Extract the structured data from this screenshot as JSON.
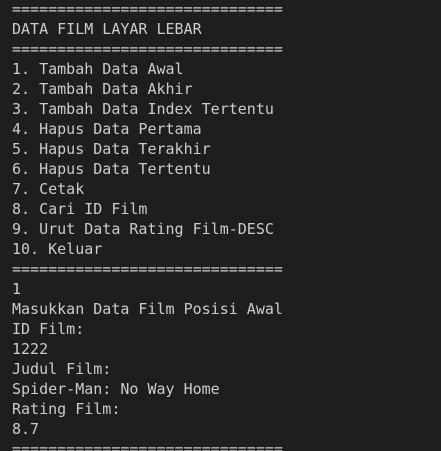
{
  "terminal": {
    "separator": "==============================",
    "title": "DATA FILM LAYAR LEBAR",
    "menu": [
      "1. Tambah Data Awal",
      "2. Tambah Data Akhir",
      "3. Tambah Data Index Tertentu",
      "4. Hapus Data Pertama",
      "5. Hapus Data Terakhir",
      "6. Hapus Data Tertentu",
      "7. Cetak",
      "8. Cari ID Film",
      "9. Urut Data Rating Film-DESC",
      "10. Keluar"
    ],
    "choice_input": "1",
    "prompt_heading": "Masukkan Data Film Posisi Awal",
    "id_label": "ID Film:",
    "id_value": "1222",
    "title_label": "Judul Film:",
    "title_value": "Spider-Man: No Way Home",
    "rating_label": "Rating Film:",
    "rating_value": "8.7",
    "bottom_separator": "=============================="
  }
}
